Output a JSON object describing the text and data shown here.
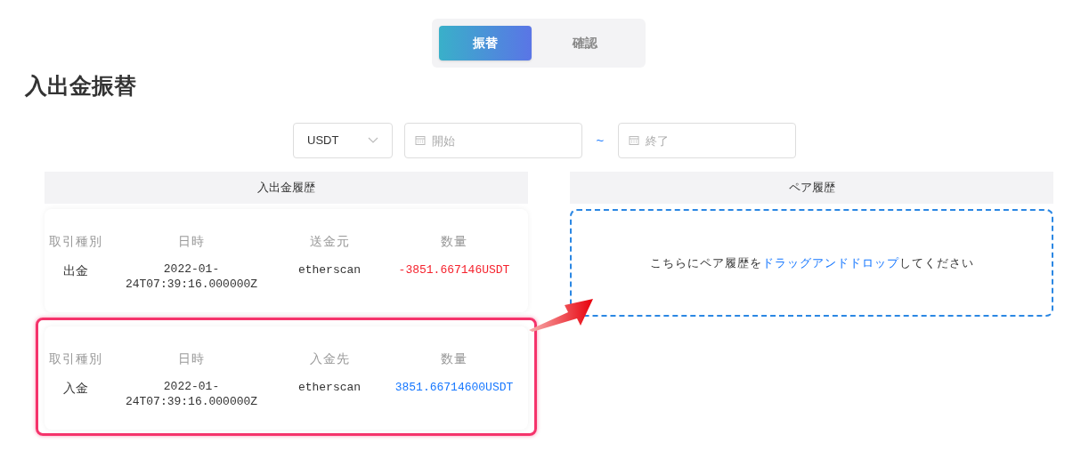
{
  "tabs": [
    {
      "label": "振替",
      "selected": true
    },
    {
      "label": "確認",
      "selected": false
    }
  ],
  "title": "入出金振替",
  "filters": {
    "currency": "USDT",
    "start": {
      "placeholder": "開始"
    },
    "separator": "~",
    "end": {
      "placeholder": "終了"
    }
  },
  "history": {
    "header": "入出金履歴",
    "records": [
      {
        "highlighted": false,
        "color": "#f5222d",
        "headers": [
          "取引種別",
          "日時",
          "送金元",
          "数量"
        ],
        "values": [
          "出金",
          "2022-01-24T07:39:16.000000Z",
          "etherscan",
          "-3851.667146USDT"
        ]
      },
      {
        "highlighted": true,
        "color": "#1677ff",
        "headers": [
          "取引種別",
          "日時",
          "入金先",
          "数量"
        ],
        "values": [
          "入金",
          "2022-01-24T07:39:16.000000Z",
          "etherscan",
          "3851.66714600USDT"
        ]
      }
    ]
  },
  "pair": {
    "header": "ペア履歴",
    "drop_text": {
      "before": "こちらにペア履歴を",
      "link": "ドラッグアンドドロップ",
      "after": "してください"
    }
  }
}
